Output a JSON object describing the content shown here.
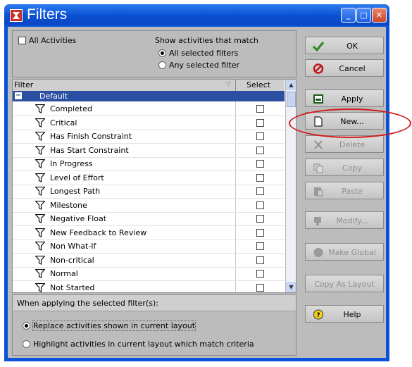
{
  "window": {
    "title": "Filters"
  },
  "top": {
    "all_activities": "All Activities",
    "show_label": "Show activities that match",
    "options": [
      "All selected filters",
      "Any selected filter"
    ]
  },
  "grid": {
    "col_filter": "Filter",
    "col_select": "Select",
    "group": "Default",
    "rows": [
      "Completed",
      "Critical",
      "Has Finish Constraint",
      "Has Start Constraint",
      "In Progress",
      "Level of Effort",
      "Longest Path",
      "Milestone",
      "Negative Float",
      "New Feedback to Review",
      "Non What-If",
      "Non-critical",
      "Normal",
      "Not Started"
    ]
  },
  "bottom": {
    "header": "When applying the selected filter(s):",
    "options": [
      "Replace activities shown in current layout",
      "Highlight activities in current layout which match criteria"
    ]
  },
  "buttons": {
    "ok": "OK",
    "cancel": "Cancel",
    "apply": "Apply",
    "new": "New...",
    "delete": "Delete",
    "copy": "Copy",
    "paste": "Paste",
    "modify": "Modify...",
    "make_global": "Make Global",
    "copy_as_layout": "Copy As Layout",
    "help": "Help"
  },
  "colors": {
    "title_bar": "#0a52d8",
    "selection": "#2b4fa3",
    "highlight_ellipse": "#d01c1c"
  }
}
